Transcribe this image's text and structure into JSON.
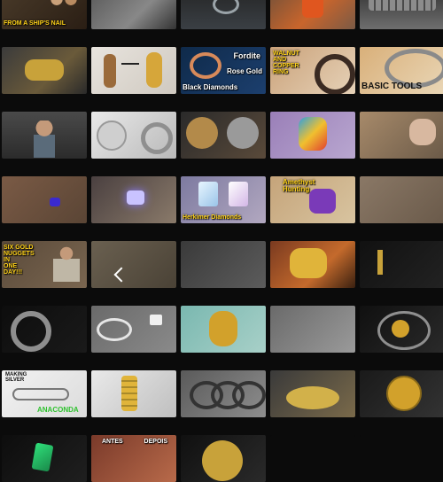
{
  "captions": {
    "ships_nail": "FROM A SHIP'S NAIL",
    "fordite": "Fordite",
    "rose_gold": "Rose Gold",
    "black_diamonds": "Black Diamonds",
    "walnut": "WALNUT\nAND\nCOPPER\nRING",
    "basic_tools": "BASIC TOOLS",
    "amethyst": "Amethyst\nHunting",
    "herkimer": "Herkimer Diamonds",
    "six_gold": "SIX GOLD\nNUGGETS\nIN\nONE\nDAY!!!",
    "making_silver": "MAKING\nSILVER",
    "anaconda": "ANACONDA",
    "antes": "ANTES",
    "depois": "DEPOIS"
  },
  "colors": {
    "page_bg": "#0b0b0b",
    "caption_yellow": "#ffd21a",
    "caption_white": "#ffffff",
    "caption_green": "#2fc22f"
  },
  "thumbnails": [
    {
      "name": "thumb-ships-nail",
      "bg": "linear-gradient(135deg,#4a3b2a,#2a1e14)"
    },
    {
      "name": "thumb-hand-stone",
      "bg": "linear-gradient(135deg,#555,#888 60%,#333)"
    },
    {
      "name": "thumb-dark-ring",
      "bg": "linear-gradient(180deg,#222,#3a3f44)"
    },
    {
      "name": "thumb-orange-glass",
      "bg": "linear-gradient(135deg,#6b4f3a,#c9652c 55%,#7a5a45)"
    },
    {
      "name": "thumb-coin-rolls",
      "bg": "linear-gradient(180deg,#2b2b2b,#6e6e6e)"
    },
    {
      "name": "thumb-brass-cannon",
      "bg": "linear-gradient(135deg,#3b3b3b,#6a5a3a 60%,#2a2a2a)"
    },
    {
      "name": "thumb-bullet-bolt",
      "bg": "linear-gradient(135deg,#e8e4de,#cfc9c0)"
    },
    {
      "name": "thumb-black-diamonds",
      "bg": "linear-gradient(135deg,#0f2a4a,#1c3f6e)"
    },
    {
      "name": "thumb-walnut-copper",
      "bg": "linear-gradient(135deg,#caa27a,#e6d2b8)"
    },
    {
      "name": "thumb-basic-tools",
      "bg": "linear-gradient(135deg,#d9b07a,#e9d6b6)"
    },
    {
      "name": "thumb-workshop-man",
      "bg": "linear-gradient(180deg,#4a4a4a,#2b2b2b)"
    },
    {
      "name": "thumb-coin-ring",
      "bg": "linear-gradient(135deg,#e9e9e9,#b9b9b9)"
    },
    {
      "name": "thumb-skull-coins",
      "bg": "linear-gradient(135deg,#2a2a2a,#5a4a3a)"
    },
    {
      "name": "thumb-opal-hand",
      "bg": "linear-gradient(135deg,#9a7fb8,#b9a7d0)"
    },
    {
      "name": "thumb-gold-sand",
      "bg": "linear-gradient(135deg,#a78a6a,#6b5a48)"
    },
    {
      "name": "thumb-red-hand-gem",
      "bg": "linear-gradient(135deg,#7a5a45,#5a4535)"
    },
    {
      "name": "thumb-purple-crystal",
      "bg": "linear-gradient(135deg,#4a4040,#8a7a6a)"
    },
    {
      "name": "thumb-herkimer",
      "bg": "linear-gradient(135deg,#7d7aa0,#b2a8c0)"
    },
    {
      "name": "thumb-amethyst",
      "bg": "linear-gradient(135deg,#c5a47a,#d8c4a0)"
    },
    {
      "name": "thumb-muddy-hands",
      "bg": "linear-gradient(135deg,#8a7866,#6a5a4a)"
    },
    {
      "name": "thumb-six-gold",
      "bg": "linear-gradient(135deg,#5a4a3a,#7a6650)"
    },
    {
      "name": "thumb-rock-pile",
      "bg": "linear-gradient(135deg,#6a6050,#4a4236)"
    },
    {
      "name": "thumb-dark-rocks",
      "bg": "linear-gradient(135deg,#3a3a3a,#5c5c5c)"
    },
    {
      "name": "thumb-gold-nuggets",
      "bg": "linear-gradient(135deg,#7a3a20,#c46a2c 60%,#3a2010)"
    },
    {
      "name": "thumb-small-bolt",
      "bg": "linear-gradient(135deg,#111,#222)"
    },
    {
      "name": "thumb-silver-spinner",
      "bg": "linear-gradient(135deg,#0d0d0d,#1a1a1a)"
    },
    {
      "name": "thumb-ring-sketch",
      "bg": "linear-gradient(135deg,#6a6a6a,#8a8a8a)"
    },
    {
      "name": "thumb-gold-dragon",
      "bg": "linear-gradient(135deg,#7ab8b0,#a8d0c8)"
    },
    {
      "name": "thumb-metal-hand",
      "bg": "linear-gradient(135deg,#6a6a6a,#9a9a9a)"
    },
    {
      "name": "thumb-spiral-gold",
      "bg": "linear-gradient(135deg,#101010,#2a2a2a)"
    },
    {
      "name": "thumb-anaconda",
      "bg": "linear-gradient(135deg,#f2f2f2,#dcdcdc)"
    },
    {
      "name": "thumb-gold-chain",
      "bg": "linear-gradient(135deg,#e9e9e9,#bfbfbf)"
    },
    {
      "name": "thumb-braided-rings",
      "bg": "linear-gradient(135deg,#5a5a5a,#8e8e8e)"
    },
    {
      "name": "thumb-engraving",
      "bg": "linear-gradient(135deg,#3a3a3a,#7a6a4a)"
    },
    {
      "name": "thumb-gold-coin",
      "bg": "linear-gradient(135deg,#1a1a1a,#333)"
    },
    {
      "name": "thumb-green-crystal",
      "bg": "linear-gradient(135deg,#0d0d0d,#1f1f1f)"
    },
    {
      "name": "thumb-antes-depois",
      "bg": "linear-gradient(135deg,#7a3a2a,#b86a4a)"
    },
    {
      "name": "thumb-cut-coin",
      "bg": "linear-gradient(135deg,#101010,#2a2a2a)"
    },
    {
      "name": "thumb-empty-1",
      "bg": "#0b0b0b"
    },
    {
      "name": "thumb-empty-2",
      "bg": "#0b0b0b"
    }
  ]
}
